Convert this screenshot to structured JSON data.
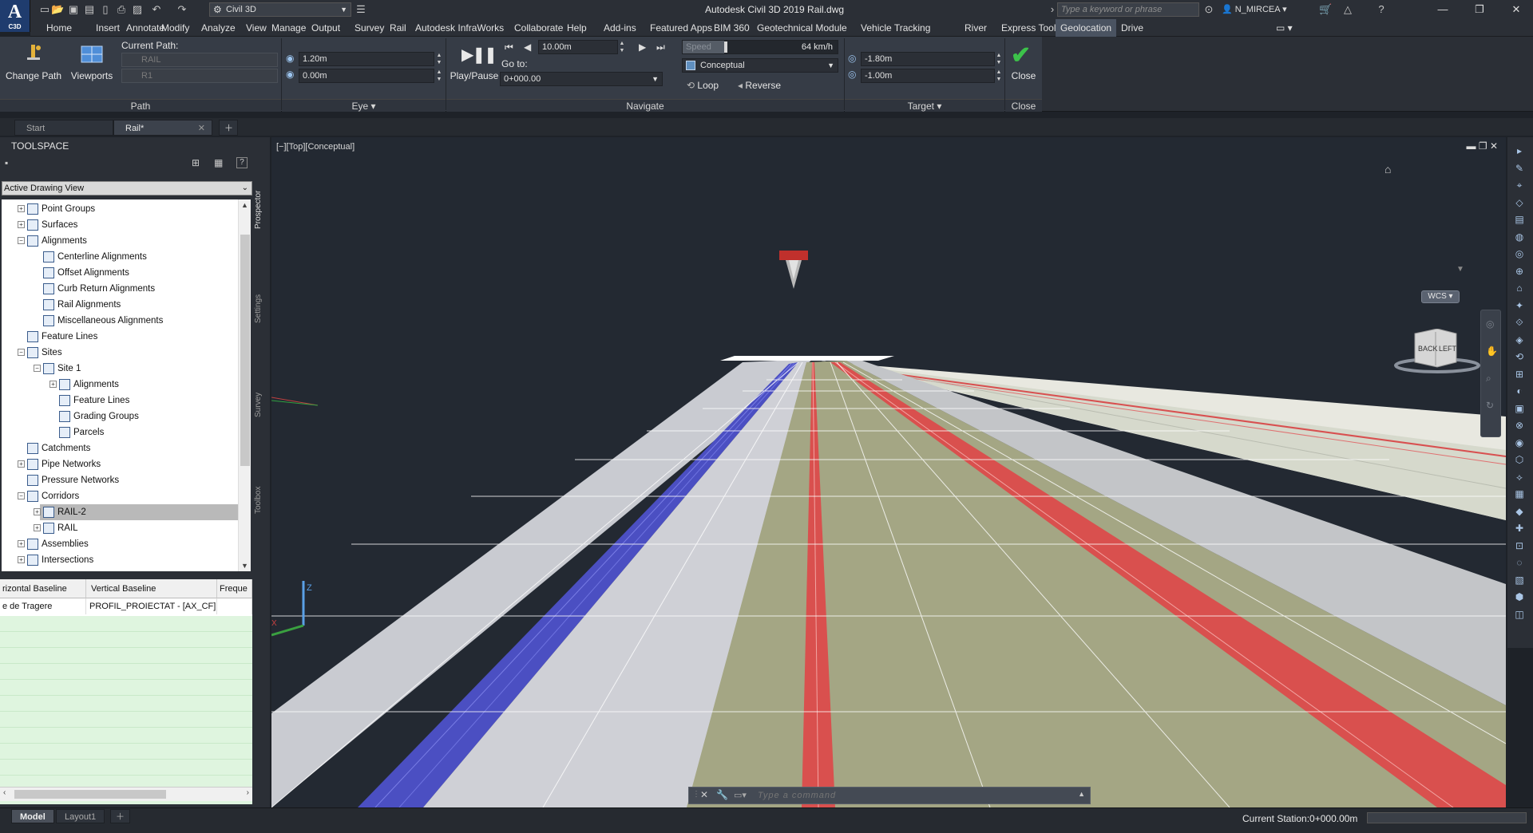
{
  "app": {
    "logo_text": "A",
    "logo_sub": "C3D",
    "title": "Autodesk Civil 3D 2019    Rail.dwg",
    "workspace": "Civil 3D",
    "search_placeholder": "Type a keyword or phrase",
    "user": "N_MIRCEA"
  },
  "menu": [
    "Home",
    "Insert",
    "Annotate",
    "Modify",
    "Analyze",
    "View",
    "Manage",
    "Output",
    "Survey",
    "Rail",
    "Autodesk InfraWorks",
    "Collaborate",
    "Help",
    "Add-ins",
    "Featured Apps",
    "BIM 360",
    "Geotechnical Module",
    "Vehicle Tracking",
    "River",
    "Express Tools",
    "Geolocation",
    "Drive"
  ],
  "menu_active": "Geolocation",
  "ribbon": {
    "path_panel": {
      "title": "Path",
      "change_path": "Change Path",
      "viewports": "Viewports",
      "current_path_label": "Current Path:",
      "path_value": "RAIL",
      "path_sub": "R1"
    },
    "eye_panel": {
      "title": "Eye",
      "height": "1.20m",
      "offset": "0.00m"
    },
    "navigate_panel": {
      "title": "Navigate",
      "play_pause": "Play/Pause",
      "step": "10.00m",
      "goto_label": "Go to:",
      "goto_value": "0+000.00",
      "speed_label": "Speed",
      "speed_value": "64 km/h",
      "visual_style": "Conceptual",
      "loop": "Loop",
      "reverse": "Reverse"
    },
    "target_panel": {
      "title": "Target",
      "v1": "-1.80m",
      "v2": "-1.00m"
    },
    "close_panel": {
      "title": "Close",
      "close": "Close"
    }
  },
  "doc_tabs": [
    "Start",
    "Rail*"
  ],
  "toolspace": {
    "title": "TOOLSPACE",
    "view": "Active Drawing View",
    "side_tabs": [
      "Prospector",
      "Settings",
      "Survey",
      "Toolbox"
    ],
    "tree": [
      {
        "label": "Point Groups",
        "level": 1,
        "exp": "+"
      },
      {
        "label": "Surfaces",
        "level": 1,
        "exp": "+"
      },
      {
        "label": "Alignments",
        "level": 1,
        "exp": "-"
      },
      {
        "label": "Centerline Alignments",
        "level": 2,
        "exp": ""
      },
      {
        "label": "Offset Alignments",
        "level": 2,
        "exp": ""
      },
      {
        "label": "Curb Return Alignments",
        "level": 2,
        "exp": ""
      },
      {
        "label": "Rail Alignments",
        "level": 2,
        "exp": ""
      },
      {
        "label": "Miscellaneous Alignments",
        "level": 2,
        "exp": ""
      },
      {
        "label": "Feature Lines",
        "level": 1,
        "exp": ""
      },
      {
        "label": "Sites",
        "level": 1,
        "exp": "-"
      },
      {
        "label": "Site 1",
        "level": 2,
        "exp": "-"
      },
      {
        "label": "Alignments",
        "level": 3,
        "exp": "+"
      },
      {
        "label": "Feature Lines",
        "level": 3,
        "exp": ""
      },
      {
        "label": "Grading Groups",
        "level": 3,
        "exp": ""
      },
      {
        "label": "Parcels",
        "level": 3,
        "exp": ""
      },
      {
        "label": "Catchments",
        "level": 1,
        "exp": ""
      },
      {
        "label": "Pipe Networks",
        "level": 1,
        "exp": "+"
      },
      {
        "label": "Pressure Networks",
        "level": 1,
        "exp": ""
      },
      {
        "label": "Corridors",
        "level": 1,
        "exp": "-"
      },
      {
        "label": "RAIL-2",
        "level": 2,
        "exp": "+",
        "selected": true
      },
      {
        "label": "RAIL",
        "level": 2,
        "exp": "+"
      },
      {
        "label": "Assemblies",
        "level": 1,
        "exp": "+"
      },
      {
        "label": "Intersections",
        "level": 1,
        "exp": "+"
      }
    ],
    "grid": {
      "headers": [
        "rizontal Baseline",
        "Vertical Baseline",
        "Freque"
      ],
      "row": [
        "e de Tragere",
        "PROFIL_PROIECTAT - [AX_CF]",
        ""
      ]
    }
  },
  "viewport": {
    "label": "[−][Top][Conceptual]",
    "viewcube_back": "BACK",
    "viewcube_left": "LEFT",
    "wcs": "WCS",
    "command_placeholder": "Type a command"
  },
  "status": {
    "layouts": [
      "Model",
      "Layout1"
    ],
    "station": "Current Station:0+000.00m"
  }
}
